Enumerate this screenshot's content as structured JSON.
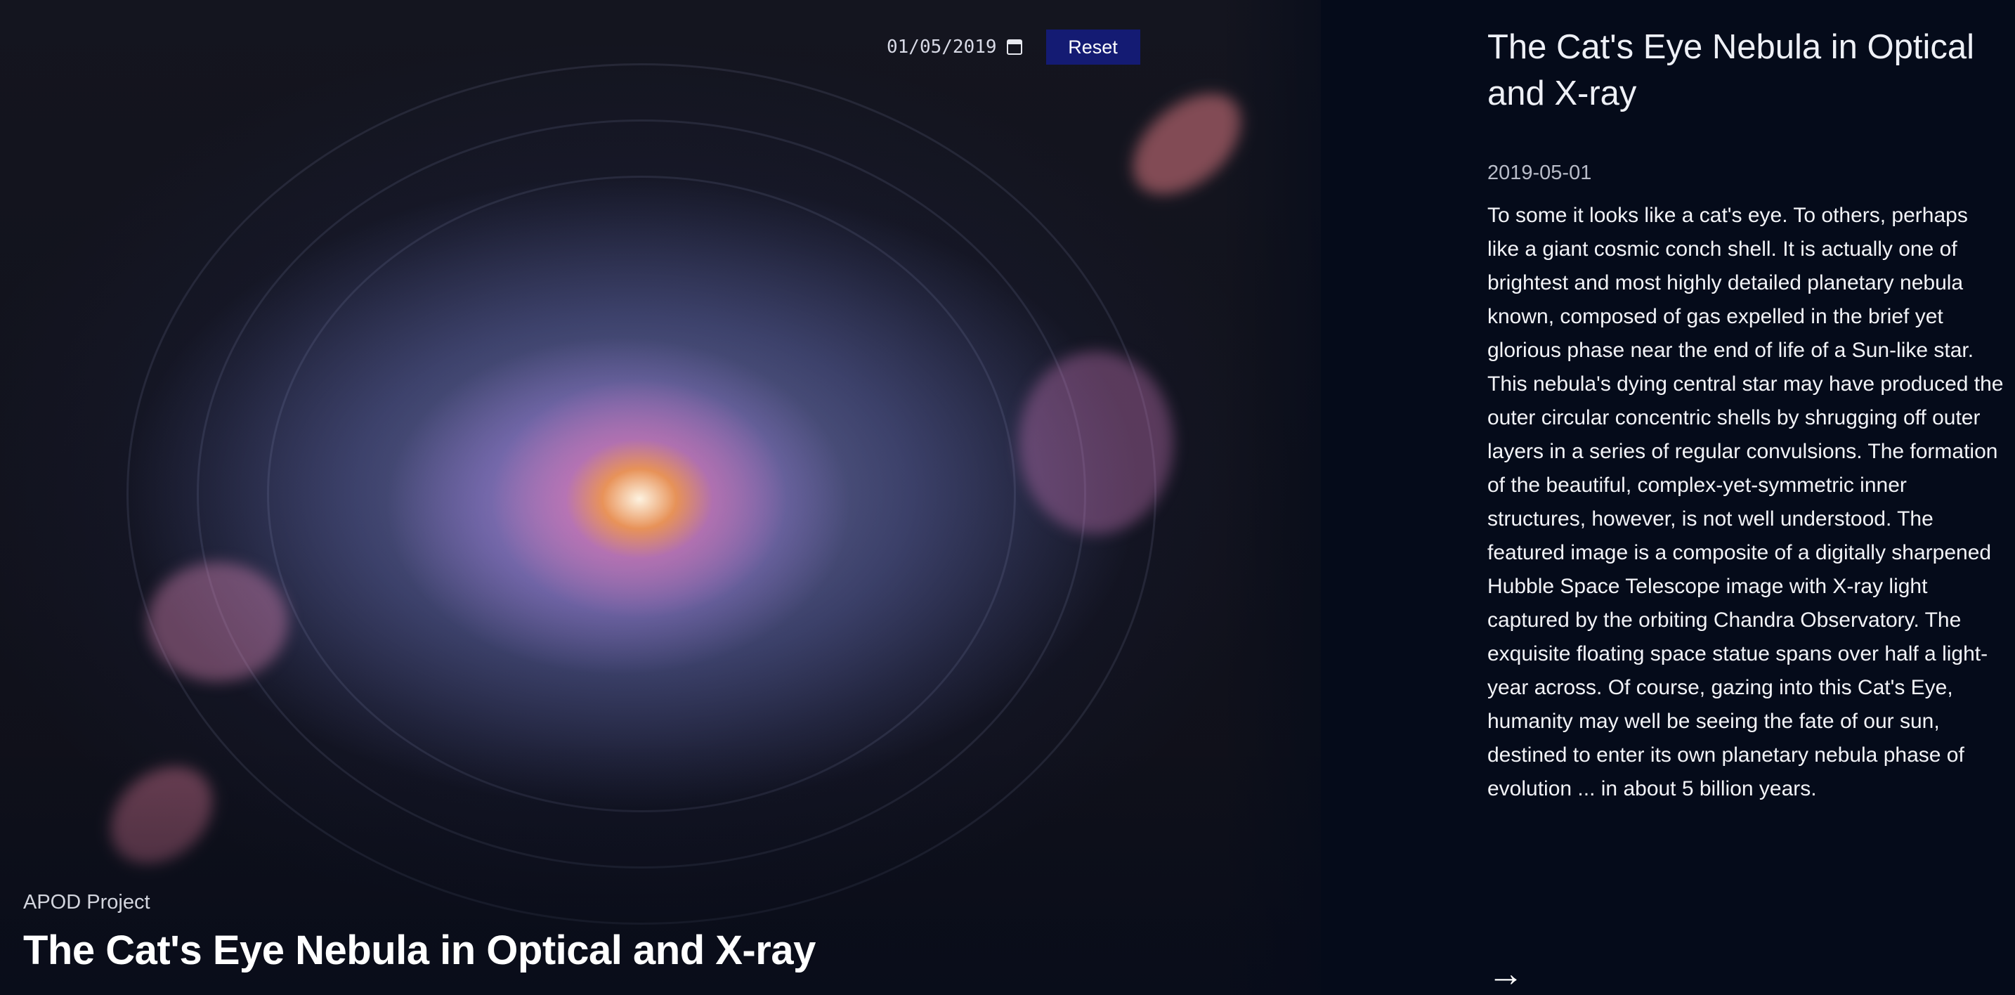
{
  "controls": {
    "date_value": "01/05/2019",
    "date_icon": "calendar-icon",
    "reset_label": "Reset",
    "reset_color": "#141b73"
  },
  "hero": {
    "project_label": "APOD Project",
    "title": "The Cat's Eye Nebula in Optical and X-ray"
  },
  "article": {
    "title": "The Cat's Eye Nebula in Optical and X-ray",
    "date": "2019-05-01",
    "description": "To some it looks like a cat's eye. To others, perhaps like a giant cosmic conch shell. It is actually one of brightest and most highly detailed planetary nebula known, composed of gas expelled in the brief yet glorious phase near the end of life of a Sun-like star. This nebula's dying central star may have produced the outer circular concentric shells by shrugging off outer layers in a series of regular convulsions. The formation of the beautiful, complex-yet-symmetric inner structures, however, is not well understood. The featured image is a composite of a digitally sharpened Hubble Space Telescope image with X-ray light captured by the orbiting Chandra Observatory. The exquisite floating space statue spans over half a light-year across. Of course, gazing into this Cat's Eye, humanity may well be seeing the fate of our sun, destined to enter its own planetary nebula phase of evolution ... in about 5 billion years.",
    "next_arrow": "→",
    "next_icon": "arrow-right-icon"
  },
  "colors": {
    "background": "#050b1a",
    "text": "#ffffff",
    "muted": "#b8bcc8"
  }
}
